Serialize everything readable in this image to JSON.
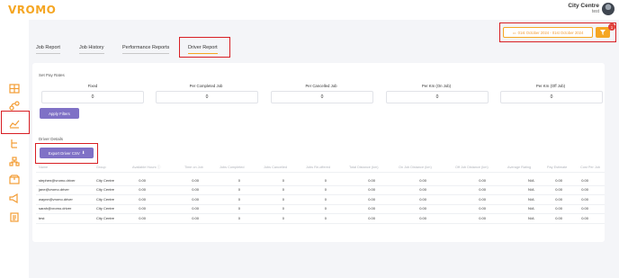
{
  "app": {
    "logo": "VROMO"
  },
  "user": {
    "name": "City Centre",
    "subtitle": "test"
  },
  "date_range": {
    "label": "01st October 2024 - 01st October 2024"
  },
  "filter": {
    "badge": "1"
  },
  "tabs": [
    {
      "label": "Job Report"
    },
    {
      "label": "Job History"
    },
    {
      "label": "Performance Reports"
    },
    {
      "label": "Driver Report"
    }
  ],
  "pay_rates": {
    "title": "Set Pay Rates",
    "fields": [
      {
        "label": "Fixed",
        "value": "0"
      },
      {
        "label": "Per Completed Job",
        "value": "0"
      },
      {
        "label": "Per Cancelled Job",
        "value": "0"
      },
      {
        "label": "Per Km (On Job)",
        "value": "0"
      },
      {
        "label": "Per Km (Off Job)",
        "value": "0"
      }
    ],
    "apply_label": "Apply Filters"
  },
  "driver_details": {
    "title": "Driver Details",
    "export_label": "Export Driver CSV",
    "columns": [
      "Name",
      "Group",
      "Available Hours",
      "Time on Job",
      "Jobs Completed",
      "Jobs Cancelled",
      "Jobs Re-offered",
      "Total Distance (km)",
      "On Job Distance (km)",
      "Off Job Distance (km)",
      "Average Rating",
      "Pay Estimate",
      "Cost Per Job"
    ],
    "rows": [
      [
        "stephen@vromo.driver",
        "City Centre",
        "0.00",
        "0.00",
        "0",
        "0",
        "0",
        "0.00",
        "0.00",
        "0.00",
        "N/A",
        "0.00",
        "0.00"
      ],
      [
        "jane@vromo.driver",
        "City Centre",
        "0.00",
        "0.00",
        "0",
        "0",
        "0",
        "0.00",
        "0.00",
        "0.00",
        "N/A",
        "0.00",
        "0.00"
      ],
      [
        "wayne@vromo.driver",
        "City Centre",
        "0.00",
        "0.00",
        "0",
        "0",
        "0",
        "0.00",
        "0.00",
        "0.00",
        "N/A",
        "0.00",
        "0.00"
      ],
      [
        "sarah@vromo.driver",
        "City Centre",
        "0.00",
        "0.00",
        "0",
        "0",
        "0",
        "0.00",
        "0.00",
        "0.00",
        "N/A",
        "0.00",
        "0.00"
      ],
      [
        "test",
        "City Centre",
        "0.00",
        "0.00",
        "0",
        "0",
        "0",
        "0.00",
        "0.00",
        "0.00",
        "N/A",
        "0.00",
        "0.00"
      ]
    ]
  },
  "sidebar": {
    "items": [
      {
        "icon": "grid-icon"
      },
      {
        "icon": "route-icon"
      },
      {
        "icon": "reports-chart-icon"
      },
      {
        "icon": "tree-icon"
      },
      {
        "icon": "hierarchy-icon"
      },
      {
        "icon": "box-icon"
      },
      {
        "icon": "megaphone-icon"
      },
      {
        "icon": "document-icon"
      }
    ]
  },
  "colors": {
    "brand": "#f5a623",
    "accent_button": "#7f71c6",
    "annotation": "#d81e23"
  }
}
